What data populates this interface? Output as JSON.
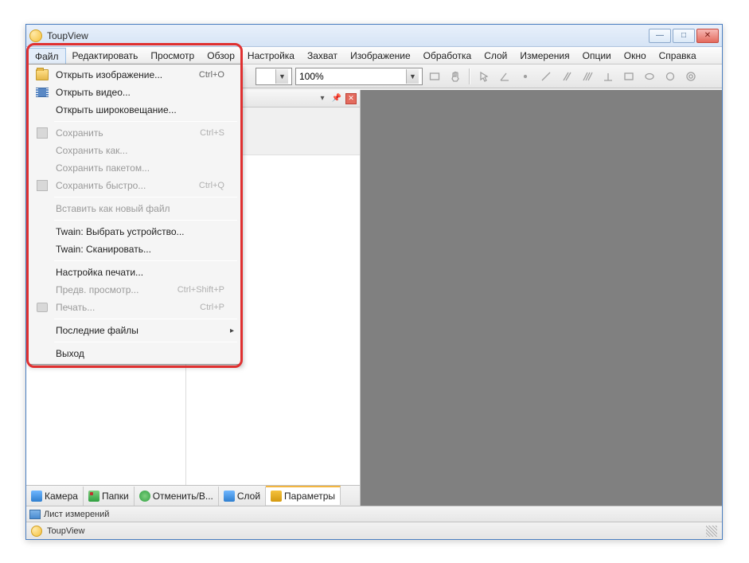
{
  "window": {
    "title": "ToupView"
  },
  "menubar": [
    "Файл",
    "Редактировать",
    "Просмотр",
    "Обзор",
    "Настройка",
    "Захват",
    "Изображение",
    "Обработка",
    "Слой",
    "Измерения",
    "Опции",
    "Окно",
    "Справка"
  ],
  "toolbar": {
    "zoom_value": "100%"
  },
  "dropdown": {
    "open_image": {
      "label": "Открыть изображение...",
      "accel": "Ctrl+O"
    },
    "open_video": {
      "label": "Открыть видео..."
    },
    "open_broadcast": {
      "label": "Открыть широковещание..."
    },
    "save": {
      "label": "Сохранить",
      "accel": "Ctrl+S"
    },
    "save_as": {
      "label": "Сохранить как..."
    },
    "save_batch": {
      "label": "Сохранить пакетом..."
    },
    "save_quick": {
      "label": "Сохранить быстро...",
      "accel": "Ctrl+Q"
    },
    "paste_new": {
      "label": "Вставить как новый файл"
    },
    "twain_select": {
      "label": "Twain: Выбрать устройство..."
    },
    "twain_scan": {
      "label": "Twain: Сканировать..."
    },
    "print_setup": {
      "label": "Настройка печати..."
    },
    "print_preview": {
      "label": "Предв. просмотр...",
      "accel": "Ctrl+Shift+P"
    },
    "print": {
      "label": "Печать...",
      "accel": "Ctrl+P"
    },
    "recent": {
      "label": "Последние файлы"
    },
    "exit": {
      "label": "Выход"
    }
  },
  "pane_tabs": {
    "camera": "Камера",
    "folders": "Папки",
    "undo": "Отменить/В...",
    "layer": "Слой",
    "params": "Параметры"
  },
  "bottom_tab": "Лист измерений",
  "status": "ToupView"
}
